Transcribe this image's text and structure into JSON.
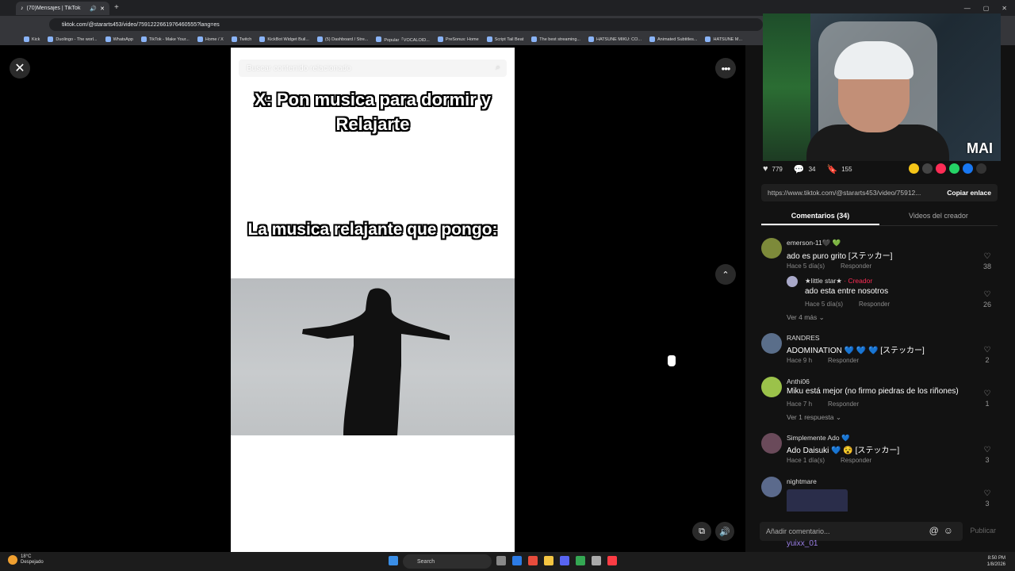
{
  "browser": {
    "tab_title": "(70)Mensajes | TikTok",
    "url": "tiktok.com/@stararts453/video/7591222661976460555?lang=es",
    "bookmarks": [
      "Kick",
      "Duolingo - The worl...",
      "WhatsApp",
      "TikTok - Make Your...",
      "Home / X",
      "Twitch",
      "KickBot Widget Buil...",
      "(5) Dashboard / Stre...",
      "Popular「VOCALOID...",
      "PreSonus: Home",
      "Script Tail Beat",
      "The best streaming...",
      "HATSUNE MIKU: CO...",
      "Animated Subtitles...",
      "HATSUNE M..."
    ]
  },
  "video": {
    "search_placeholder": "Buscar contenido relacionado",
    "caption_top": "X: Pon musica para dormir y Relajarte",
    "caption_mid": "La musica relajante que pongo:"
  },
  "overlay": {
    "mai_label": "MAI"
  },
  "stats": {
    "likes": "779",
    "comments": "34",
    "saves": "155"
  },
  "link": {
    "url": "https://www.tiktok.com/@stararts453/video/75912...",
    "copy_label": "Copiar enlace"
  },
  "tabs": {
    "comments": "Comentarios (34)",
    "creator_videos": "Videos del creador"
  },
  "comments": [
    {
      "name": "emerson-11🖤 💚",
      "text": "ado es puro grito [ステッカー]",
      "time": "Hace 5 día(s)",
      "reply": "Responder",
      "likes": "38"
    },
    {
      "name": "★little star★",
      "creator_tag": "· Creador",
      "text": "ado esta entre nosotros",
      "time": "Hace 5 día(s)",
      "reply": "Responder",
      "likes": "26"
    },
    {
      "name": "RANDRES",
      "text": "ADOMINATION 💙 💙 💙 [ステッカー]",
      "time": "Hace 9 h",
      "reply": "Responder",
      "likes": "2"
    },
    {
      "name": "Anthi06",
      "text": "Miku está mejor (no firmo piedras de los riñones)",
      "time": "Hace 7 h",
      "reply": "Responder",
      "likes": "1"
    },
    {
      "name": "Simplemente Ado 💙",
      "text": "Ado Daisuki 💙 😵 [ステッカー]",
      "time": "Hace 1 día(s)",
      "reply": "Responder",
      "likes": "3"
    },
    {
      "name": "nightmare",
      "likes": "3"
    }
  ],
  "more_replies_1": "Ver 4 más",
  "more_replies_2": "Ver 1 respuesta",
  "composer": {
    "placeholder": "Añadir comentario...",
    "publish": "Publicar"
  },
  "floating_user": "yuixx_01",
  "taskbar": {
    "weather_temp": "18°C",
    "weather_desc": "Despejado",
    "search": "Search",
    "time": "8:50 PM",
    "date": "1/8/2026"
  }
}
